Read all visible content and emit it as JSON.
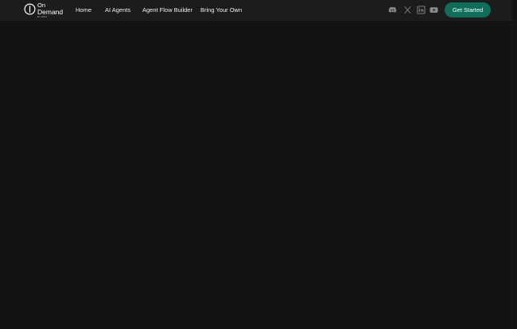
{
  "header": {
    "logo": {
      "line1": "On",
      "line2": "Demand",
      "byline": "BY AIRAI"
    },
    "nav": [
      {
        "label": "Home"
      },
      {
        "label": "AI Agents"
      },
      {
        "label": "Agent Flow Builder"
      },
      {
        "label": "Bring Your Own"
      }
    ],
    "social_icons": [
      "discord-icon",
      "x-icon",
      "linkedin-icon",
      "youtube-icon"
    ],
    "cta_label": "Get Started"
  },
  "colors": {
    "background": "#121212",
    "header": "#1c1c1c",
    "accent": "#0f6e5a",
    "icon": "#8a8a8a"
  }
}
